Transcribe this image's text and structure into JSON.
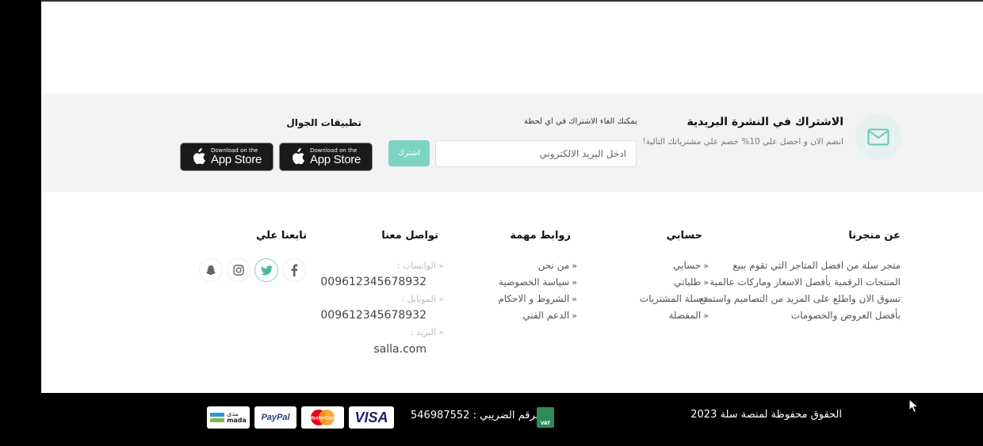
{
  "newsletter": {
    "title": "الاشتراك في النشرة البريدية",
    "subtitle": "انضم الان و احصل علي 10% خصم علي مشترياتك التالية!",
    "cancel_note": "يمكنك الغاء الاشتراك في اي لحظة",
    "email_placeholder": "ادخل البريد الالكتروني",
    "subscribe_label": "اشترك",
    "icon": "mail-icon"
  },
  "apps": {
    "title": "تطبيقات الجوال",
    "stores": [
      {
        "small": "Download on the",
        "big": "App Store"
      },
      {
        "small": "Download on the",
        "big": "App Store"
      }
    ]
  },
  "footer": {
    "about": {
      "title": "عن متجرنا",
      "lines": [
        "متجر سلة من افضل المتاجر التي تقوم ببيع",
        "المنتجات الرقمية بأفضل الاسعار وماركات عالمية",
        "تسوق الان واطلع على المزيد من التصاميم واستمتع",
        "بأفضل العروض والخصومات"
      ]
    },
    "account": {
      "title": "حسابي",
      "links": [
        "حسابي",
        "طلباتي",
        "سلة المشتريات",
        "المفضلة"
      ]
    },
    "important": {
      "title": "روابط مهمة",
      "links": [
        "من نحن",
        "سياسة الخصوصية",
        "الشروط و الاحكام",
        "الدعم الفني"
      ]
    },
    "contact": {
      "title": "تواصل معنا",
      "whatsapp_label": "الواتساب :",
      "whatsapp": "009612345678932",
      "mobile_label": "الموبايل :",
      "mobile": "009612345678932",
      "email_label": "البريد :",
      "email": "salla.com"
    },
    "follow": {
      "title": "تابعنا علي",
      "icons": [
        "facebook-icon",
        "twitter-icon",
        "instagram-icon",
        "snapchat-icon"
      ]
    }
  },
  "bottom": {
    "copyright": "الحقوق محفوظة لمنصة سلة 2023",
    "tax_label": "الرقم الضريبي :",
    "tax_number": "546987552",
    "vat_badge": "VAT",
    "payments": [
      "VISA",
      "MasterCard",
      "PayPal",
      "mada"
    ],
    "mada_arabic": "مدى",
    "accent": "#7dd4c2"
  }
}
